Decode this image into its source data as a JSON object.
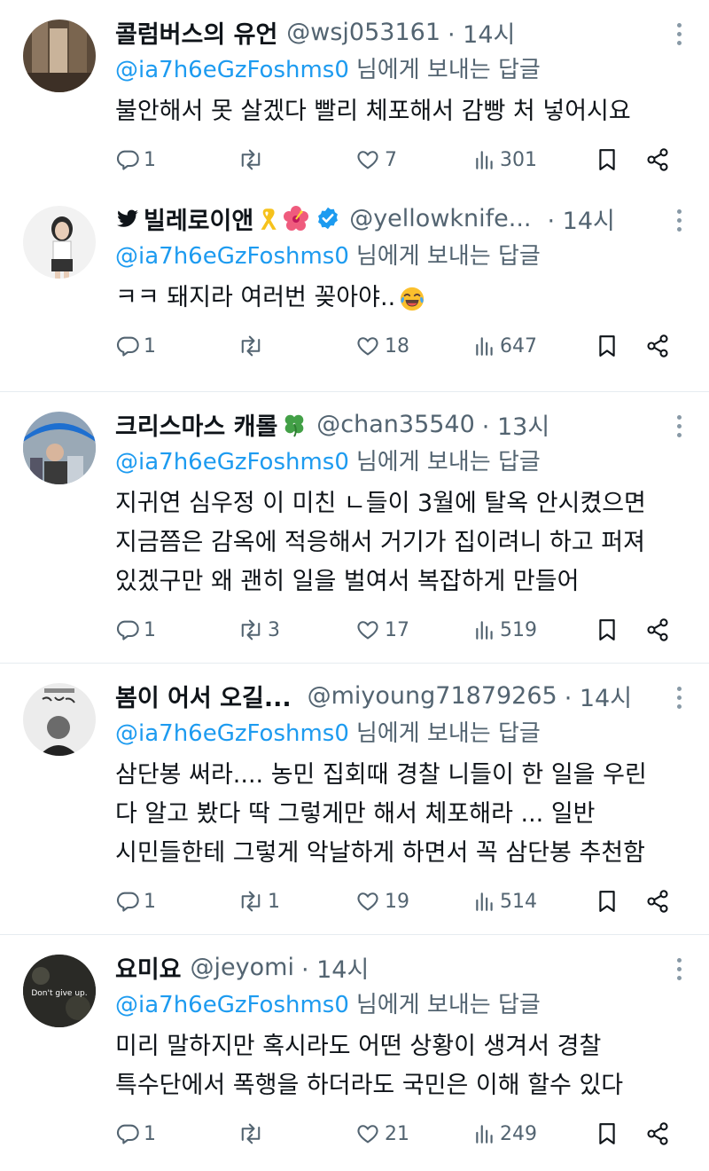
{
  "reply_suffix": "님에게 보내는 답글",
  "tweets": [
    {
      "name": "콜럼버스의 유언",
      "handle": "@wsj053161",
      "time": "· 14시",
      "reply_to": "@ia7h6eGzFoshms0",
      "lines": [
        "불안해서 못 살겠다 빨리 체포해서 감빵 처 넣어시요"
      ],
      "replies": "1",
      "retweets": "",
      "likes": "7",
      "views": "301"
    },
    {
      "name": "빌레로이앤",
      "handle": "@yellowknife...",
      "time": "· 14시",
      "reply_to": "@ia7h6eGzFoshms0",
      "lines": [
        "ㅋㅋ 돼지라 여러번 꽂아야.."
      ],
      "replies": "1",
      "retweets": "",
      "likes": "18",
      "views": "647"
    },
    {
      "name": "크리스마스 캐롤",
      "handle": "@chan35540",
      "time": "· 13시",
      "reply_to": "@ia7h6eGzFoshms0",
      "lines": [
        "지귀연 심우정 이 미친 ㄴ들이 3월에 탈옥 안시켰으면",
        "지금쯤은 감옥에 적응해서 거기가 집이려니 하고 퍼져",
        "있겠구만 왜 괜히 일을 벌여서 복잡하게 만들어"
      ],
      "replies": "1",
      "retweets": "3",
      "likes": "17",
      "views": "519"
    },
    {
      "name": "봄이 어서 오길...",
      "handle": "@miyoung71879265",
      "time": "· 14시",
      "reply_to": "@ia7h6eGzFoshms0",
      "lines": [
        "삼단봉 써라.... 농민 집회때 경찰 니들이 한 일을 우린",
        "다 알고 봤다 딱 그렇게만 해서 체포해라 ... 일반",
        "시민들한테 그렇게 악날하게 하면서 꼭 삼단봉 추천함"
      ],
      "replies": "1",
      "retweets": "1",
      "likes": "19",
      "views": "514"
    },
    {
      "name": "요미요",
      "handle": "@jeyomi",
      "time": "· 14시",
      "reply_to": "@ia7h6eGzFoshms0",
      "lines": [
        "미리 말하지만 혹시라도 어떤 상황이 생겨서 경찰",
        "특수단에서 폭행을 하더라도 국민은 이해 할수 있다"
      ],
      "replies": "1",
      "retweets": "",
      "likes": "21",
      "views": "249",
      "avatar_text": "Don't give up."
    }
  ],
  "icons": {
    "reply": "reply-icon",
    "retweet": "retweet-icon",
    "like": "heart-icon",
    "views": "views-chart-icon",
    "bookmark": "bookmark-icon",
    "share": "share-icon",
    "more": "more-vertical-icon",
    "verified": "verified-badge-icon",
    "bird": "bird-icon",
    "ribbon": "yellow-ribbon-icon",
    "flower": "hibiscus-icon",
    "clover": "four-leaf-clover-icon",
    "laugh": "tears-of-joy-emoji"
  },
  "colors": {
    "link": "#1d9bf0",
    "muted": "#536471",
    "text": "#0f1419",
    "verified": "#1d9bf0"
  }
}
